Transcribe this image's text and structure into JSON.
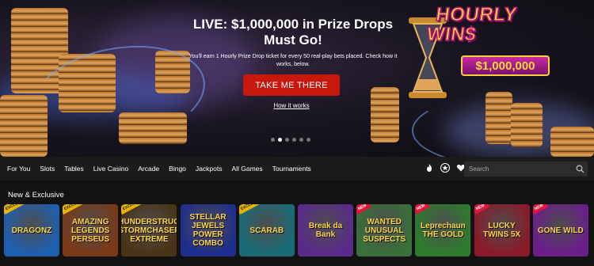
{
  "hero": {
    "title": "LIVE: $1,000,000 in Prize Drops Must Go!",
    "subtitle": "You'll earn 1 Hourly Prize Drop ticket for every 50 real-play bets placed. Check how it works, below.",
    "cta_label": "TAKE ME THERE",
    "how_link": "How it works",
    "promo_line1": "HOURLY",
    "promo_line2": "WIN$",
    "promo_amount": "$1,000,000",
    "carousel_dots": 6,
    "carousel_active": 1
  },
  "nav": {
    "items": [
      "For You",
      "Slots",
      "Tables",
      "Live Casino",
      "Arcade",
      "Bingo",
      "Jackpots",
      "All Games",
      "Tournaments"
    ],
    "icons": [
      "fire-icon",
      "star-icon",
      "heart-icon"
    ],
    "search_placeholder": "Search"
  },
  "section": {
    "title": "New & Exclusive",
    "tiles": [
      {
        "name": "DRAGONZ",
        "tag": "EXCLUSIVE",
        "bg": "#1f5fb0"
      },
      {
        "name": "AMAZING LEGENDS PERSEUS",
        "tag": "EXCLUSIVE",
        "bg": "#7a3a1a"
      },
      {
        "name": "THUNDERSTRUCK STORMCHASER EXTREME",
        "tag": "EXCLUSIVE",
        "bg": "#4a3418"
      },
      {
        "name": "STELLAR JEWELS POWER COMBO",
        "tag": "",
        "bg": "#1f2e8c"
      },
      {
        "name": "SCARAB",
        "tag": "EXCLUSIVE",
        "bg": "#1a6b78"
      },
      {
        "name": "Break da Bank",
        "tag": "",
        "bg": "#5a2a8a"
      },
      {
        "name": "WANTED UNUSUAL SUSPECTS",
        "tag": "NEW",
        "bg": "#3a6e3a"
      },
      {
        "name": "Leprechaun THE GOLD",
        "tag": "NEW",
        "bg": "#2e7a2e"
      },
      {
        "name": "LUCKY TWINS 5X",
        "tag": "NEW",
        "bg": "#8a1a2a"
      },
      {
        "name": "GONE WILD",
        "tag": "NEW",
        "bg": "#6a1e8a"
      }
    ]
  },
  "colors": {
    "cta": "#c8180d",
    "nav_bg": "#1b1b1b",
    "page_bg": "#121212",
    "promo_gold": "#ffd93a",
    "promo_magenta": "#b31a7a"
  }
}
